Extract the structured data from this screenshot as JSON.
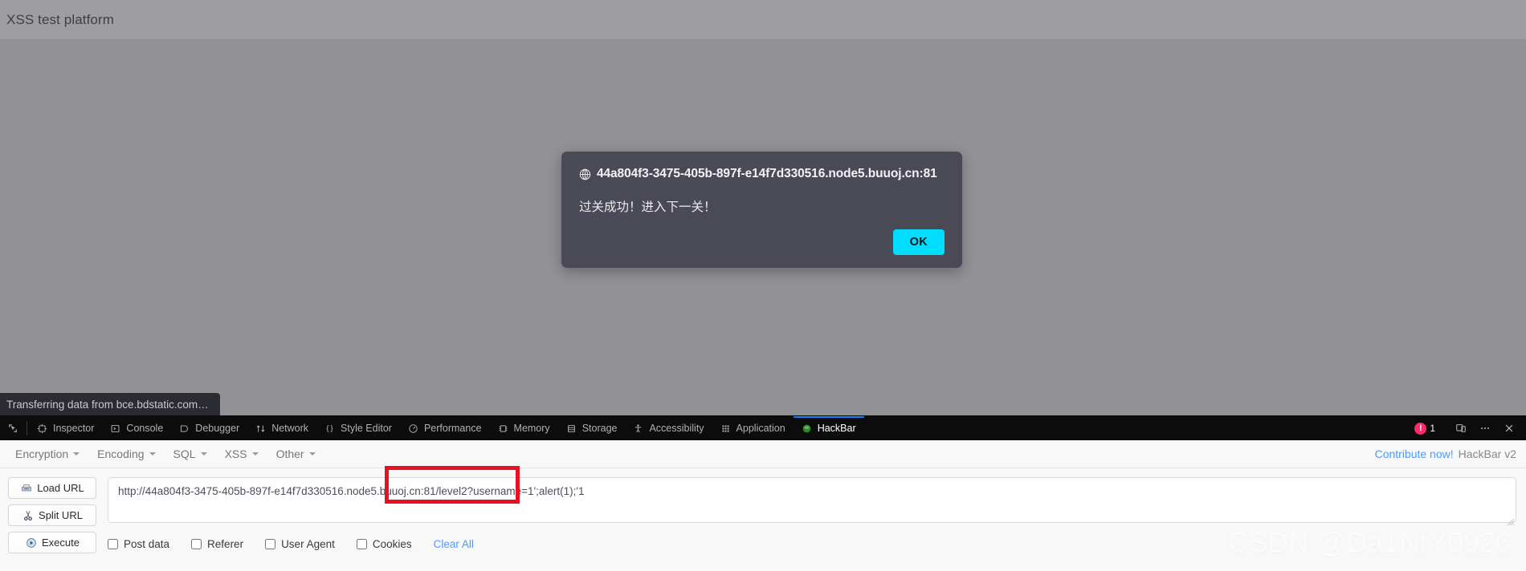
{
  "page": {
    "header_title": "XSS test platform",
    "background_color": "#919196",
    "status_text": "Transferring data from bce.bdstatic.com…"
  },
  "dialog": {
    "origin": "44a804f3-3475-405b-897f-e14f7d330516.node5.buuoj.cn:81",
    "message": "过关成功！进入下一关！",
    "ok_label": "OK",
    "accent_color": "#00ddff",
    "background_color": "#4a4a57"
  },
  "devtools": {
    "tabs": [
      {
        "label": "Inspector",
        "icon": "inspector-icon",
        "active": false
      },
      {
        "label": "Console",
        "icon": "console-icon",
        "active": false
      },
      {
        "label": "Debugger",
        "icon": "debugger-icon",
        "active": false
      },
      {
        "label": "Network",
        "icon": "network-icon",
        "active": false
      },
      {
        "label": "Style Editor",
        "icon": "style-editor-icon",
        "active": false
      },
      {
        "label": "Performance",
        "icon": "performance-icon",
        "active": false
      },
      {
        "label": "Memory",
        "icon": "memory-icon",
        "active": false
      },
      {
        "label": "Storage",
        "icon": "storage-icon",
        "active": false
      },
      {
        "label": "Accessibility",
        "icon": "accessibility-icon",
        "active": false
      },
      {
        "label": "Application",
        "icon": "application-icon",
        "active": false
      },
      {
        "label": "HackBar",
        "icon": "hackbar-icon",
        "active": true
      }
    ],
    "error_count": "1",
    "error_badge_color": "#ff2a6a",
    "active_tab_underline_color": "#0a84ff"
  },
  "hackbar": {
    "menus": [
      {
        "label": "Encryption"
      },
      {
        "label": "Encoding"
      },
      {
        "label": "SQL"
      },
      {
        "label": "XSS"
      },
      {
        "label": "Other"
      }
    ],
    "contribute_label": "Contribute now!",
    "version_label": "HackBar v2",
    "buttons": [
      {
        "label": "Load URL",
        "icon": "load-url-icon"
      },
      {
        "label": "Split URL",
        "icon": "split-url-icon"
      },
      {
        "label": "Execute",
        "icon": "execute-icon"
      }
    ],
    "url_value": "http://44a804f3-3475-405b-897f-e14f7d330516.node5.buuoj.cn:81/level2?username=1';alert(1);'1",
    "url_placeholder": "",
    "checkboxes": [
      {
        "label": "Post data",
        "checked": false
      },
      {
        "label": "Referer",
        "checked": false
      },
      {
        "label": "User Agent",
        "checked": false
      },
      {
        "label": "Cookies",
        "checked": false
      }
    ],
    "clear_all_label": "Clear All",
    "highlight_color": "#e81123"
  },
  "watermark": {
    "text": "CSDN @Da1NtY0926"
  }
}
